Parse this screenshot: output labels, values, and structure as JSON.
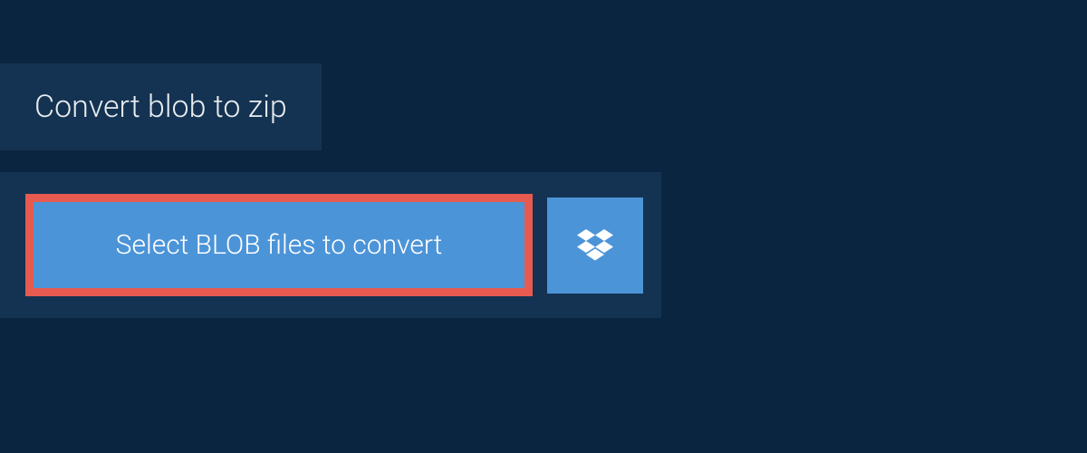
{
  "tab": {
    "title": "Convert blob to zip"
  },
  "actions": {
    "select_label": "Select BLOB files to convert"
  },
  "colors": {
    "bg": "#0a2540",
    "panel": "#143352",
    "button": "#4c94d8",
    "highlight_border": "#e65a50"
  }
}
